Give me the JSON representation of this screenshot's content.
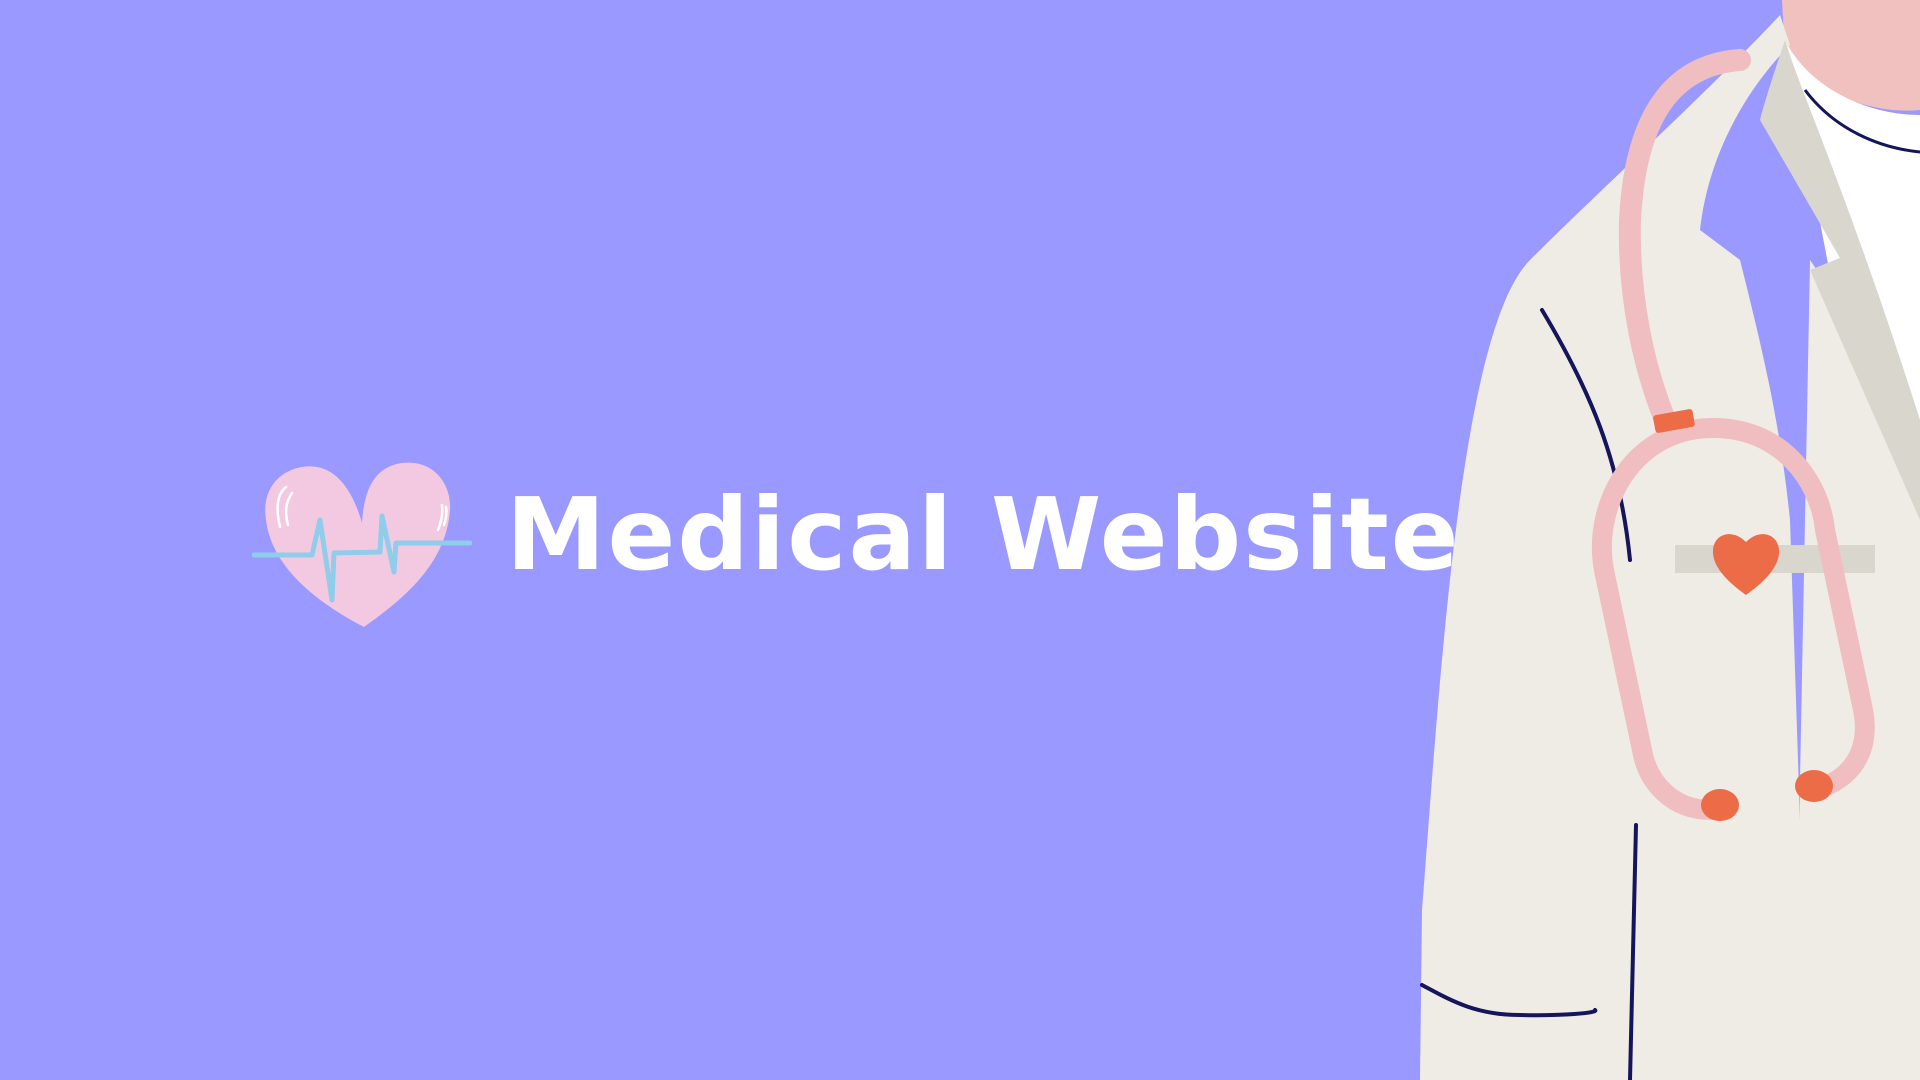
{
  "page": {
    "title": "Medical Website"
  },
  "logo": {
    "icon": "heartbeat-heart-icon"
  },
  "illustration": {
    "subject": "doctor-with-stethoscope",
    "pocket_icon": "heart-icon"
  },
  "colors": {
    "background": "#9999FF",
    "title_text": "#FFFFFF",
    "heart_pink": "#F3C9E2",
    "pulse_line": "#8FCDEB",
    "coat": "#EFECE6",
    "coat_shadow": "#D9D6CE",
    "skin": "#F1C1C0",
    "stethoscope": "#F0BEC0",
    "accent_orange": "#EC6C48",
    "outline_navy": "#14155C"
  }
}
